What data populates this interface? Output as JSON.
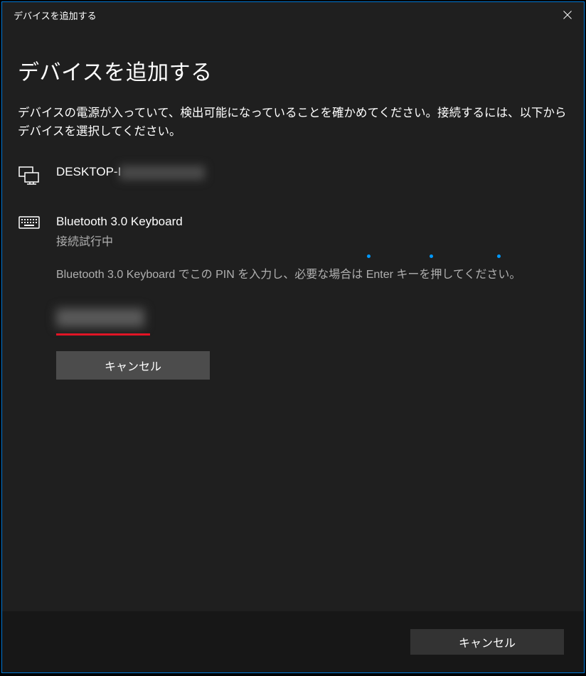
{
  "titlebar": {
    "title": "デバイスを追加する"
  },
  "heading": "デバイスを追加する",
  "description": "デバイスの電源が入っていて、検出可能になっていることを確かめてください。接続するには、以下からデバイスを選択してください。",
  "devices": {
    "desktop": {
      "name_prefix": "DESKTOP-I"
    },
    "keyboard": {
      "name": "Bluetooth 3.0 Keyboard",
      "status": "接続試行中",
      "instruction": "Bluetooth 3.0 Keyboard でこの PIN を入力し、必要な場合は Enter キーを押してください。",
      "cancel_label": "キャンセル"
    }
  },
  "footer": {
    "cancel_label": "キャンセル"
  }
}
